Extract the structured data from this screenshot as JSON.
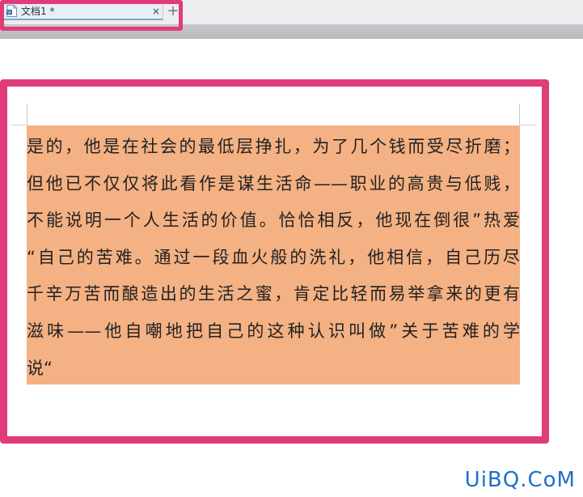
{
  "tab": {
    "title": "文档1 *",
    "close_glyph": "×",
    "new_tab_glyph": "+"
  },
  "document": {
    "lines": [
      "是的，他是在社会的最低层挣扎，为了几个钱而受尽折磨；",
      "但他已不仅仅将此看作是谋生活命——职业的高贵与低贱，",
      "不能说明一个人生活的价值。恰恰相反，他现在倒很”热爱",
      "“自己的苦难。通过一段血火般的洗礼，他相信，自己历尽",
      "千辛万苦而酿造出的生活之蜜，肯定比轻而易举拿来的更有",
      "滋味——他自嘲地把自己的这种认识叫做”关于苦难的学",
      "说“"
    ]
  },
  "watermark": "UiBQ.CoM",
  "colors": {
    "highlight_border": "#e03c7a",
    "selection": "#f4b183",
    "watermark": "#1f6fc9"
  }
}
